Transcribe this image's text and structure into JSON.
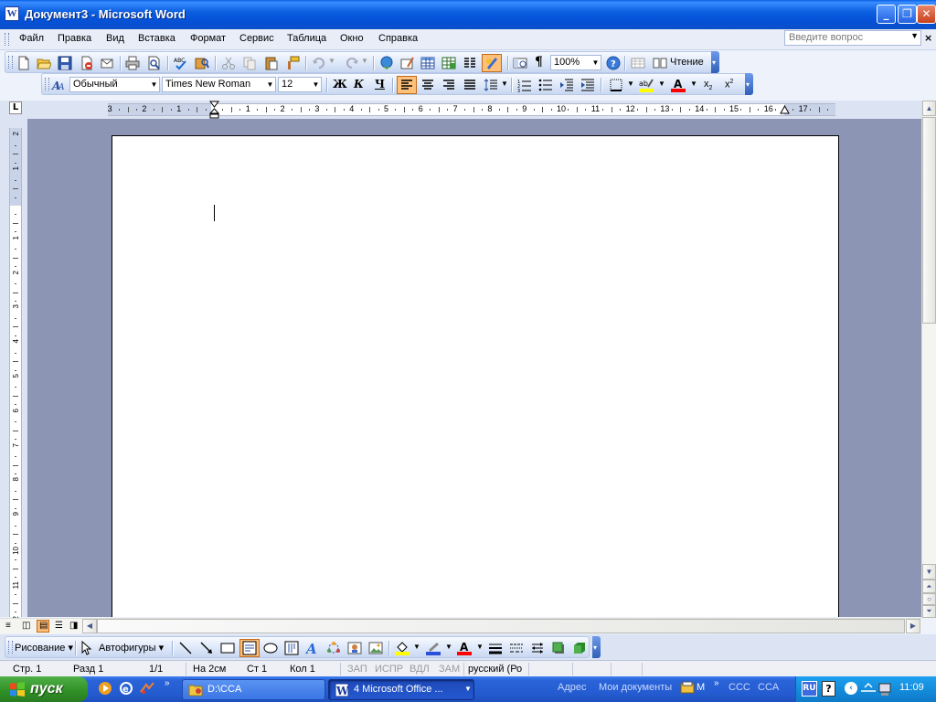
{
  "window": {
    "title": "Документ3 - Microsoft Word",
    "app_icon": "word-icon"
  },
  "menu": {
    "items": [
      "Файл",
      "Правка",
      "Вид",
      "Вставка",
      "Формат",
      "Сервис",
      "Таблица",
      "Окно",
      "Справка"
    ],
    "help_placeholder": "Введите вопрос"
  },
  "standard_toolbar": {
    "zoom": "100%",
    "reading_label": "Чтение"
  },
  "formatting_toolbar": {
    "style": "Обычный",
    "font": "Times New Roman",
    "size": "12",
    "bold": "Ж",
    "italic": "К",
    "underline": "Ч"
  },
  "ruler": {
    "h_labels": [
      "3",
      "2",
      "1",
      "1",
      "2",
      "3",
      "4",
      "5",
      "6",
      "7",
      "8",
      "9",
      "10",
      "11",
      "12",
      "13",
      "14",
      "15",
      "16",
      "17"
    ],
    "v_labels": [
      "2",
      "1",
      "1",
      "2",
      "3",
      "4",
      "5",
      "6",
      "7",
      "8",
      "9",
      "10",
      "11",
      "12"
    ],
    "tab_selector": "L"
  },
  "drawing_toolbar": {
    "draw_label": "Рисование",
    "autoshapes_label": "Автофигуры"
  },
  "statusbar": {
    "page": "Стр. 1",
    "section": "Разд 1",
    "pages": "1/1",
    "at": "На 2см",
    "line": "Ст 1",
    "col": "Кол 1",
    "rec": "ЗАП",
    "trk": "ИСПР",
    "ext": "ВДЛ",
    "ovr": "ЗАМ",
    "language": "русский (Ро"
  },
  "taskbar": {
    "start_label": "пуск",
    "buttons": [
      "D:\\CCA",
      "4 Microsoft Office ..."
    ],
    "address_label": "Адрес",
    "address_value": "Мои документы",
    "tray_items": [
      "M",
      "CCC",
      "CCA"
    ],
    "lang": "RU",
    "clock": "11:09"
  },
  "colors": {
    "titlebar": "#0a5fe6",
    "document_bg": "#8c95b4",
    "taskbar": "#245bd0",
    "start_green": "#2f8f26"
  }
}
